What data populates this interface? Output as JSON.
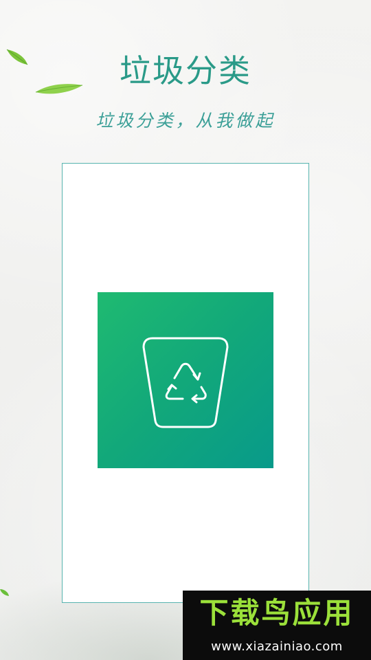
{
  "header": {
    "title": "垃圾分类",
    "subtitle": "垃圾分类，从我做起"
  },
  "icons": {
    "leaf": "leaf-icon",
    "app": "recycle-bin-icon"
  },
  "colors": {
    "title": "#2a9a88",
    "subtitle": "#3b9f97",
    "card_border": "#56b3ae",
    "icon_gradient_start": "#1fba71",
    "icon_gradient_end": "#089a8a",
    "watermark_bg": "#0c0c0c",
    "watermark_brand": "#9be03a"
  },
  "watermark": {
    "brand": "下载鸟应用",
    "url": "www.xiazainiao.com"
  }
}
